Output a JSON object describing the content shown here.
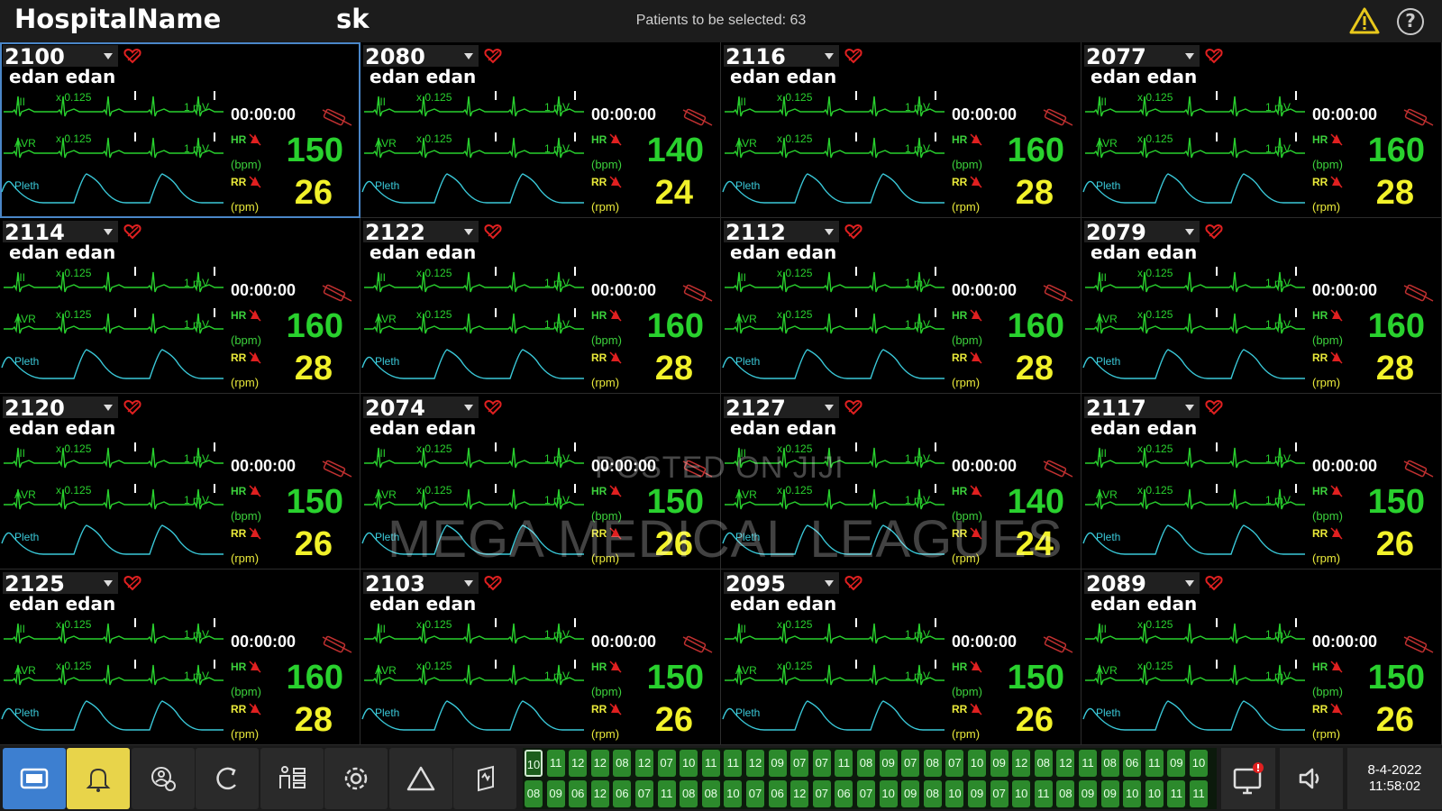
{
  "header": {
    "hospital_name": "HospitalName",
    "user": "sk",
    "patients_to_select": "Patients to be selected: 63"
  },
  "colors": {
    "ecg": "#29d12e",
    "pleth": "#3ac9d9",
    "hr": "#29d12e",
    "rr": "#f2f22a",
    "alarm": "#e02020",
    "selected_border": "#4a86c8"
  },
  "lead_labels": {
    "lead1": "III",
    "lead2": "AVR",
    "pleth": "Pleth",
    "gain": "x 0.125",
    "scale": "1 mV"
  },
  "units": {
    "hr_label": "HR",
    "hr_unit": "(bpm)",
    "rr_label": "RR",
    "rr_unit": "(rpm)"
  },
  "patients": [
    {
      "bed": "2100",
      "name": "edan edan",
      "time": "00:00:00",
      "hr": "150",
      "rr": "26"
    },
    {
      "bed": "2080",
      "name": "edan edan",
      "time": "00:00:00",
      "hr": "140",
      "rr": "24"
    },
    {
      "bed": "2116",
      "name": "edan edan",
      "time": "00:00:00",
      "hr": "160",
      "rr": "28"
    },
    {
      "bed": "2077",
      "name": "edan edan",
      "time": "00:00:00",
      "hr": "160",
      "rr": "28"
    },
    {
      "bed": "2114",
      "name": "edan edan",
      "time": "00:00:00",
      "hr": "160",
      "rr": "28"
    },
    {
      "bed": "2122",
      "name": "edan edan",
      "time": "00:00:00",
      "hr": "160",
      "rr": "28"
    },
    {
      "bed": "2112",
      "name": "edan edan",
      "time": "00:00:00",
      "hr": "160",
      "rr": "28"
    },
    {
      "bed": "2079",
      "name": "edan edan",
      "time": "00:00:00",
      "hr": "160",
      "rr": "28"
    },
    {
      "bed": "2120",
      "name": "edan edan",
      "time": "00:00:00",
      "hr": "150",
      "rr": "26"
    },
    {
      "bed": "2074",
      "name": "edan edan",
      "time": "00:00:00",
      "hr": "150",
      "rr": "26"
    },
    {
      "bed": "2127",
      "name": "edan edan",
      "time": "00:00:00",
      "hr": "140",
      "rr": "24"
    },
    {
      "bed": "2117",
      "name": "edan edan",
      "time": "00:00:00",
      "hr": "150",
      "rr": "26"
    },
    {
      "bed": "2125",
      "name": "edan edan",
      "time": "00:00:00",
      "hr": "160",
      "rr": "28"
    },
    {
      "bed": "2103",
      "name": "edan edan",
      "time": "00:00:00",
      "hr": "150",
      "rr": "26"
    },
    {
      "bed": "2095",
      "name": "edan edan",
      "time": "00:00:00",
      "hr": "150",
      "rr": "26"
    },
    {
      "bed": "2089",
      "name": "edan edan",
      "time": "00:00:00",
      "hr": "150",
      "rr": "26"
    }
  ],
  "watermark": {
    "line1": "POSTED ON JIJI",
    "line2": "MEGA MEDICAL LEAGUES"
  },
  "toolbar": {
    "icons": [
      "main-screen-icon",
      "alarm-bell-icon",
      "patient-admit-icon",
      "review-icon",
      "bed-view-icon",
      "settings-gear-icon",
      "alarm-limits-icon",
      "report-icon"
    ],
    "timeline_top": [
      "10",
      "11",
      "12",
      "12",
      "08",
      "12",
      "07",
      "10",
      "11",
      "11",
      "12",
      "09",
      "07",
      "07",
      "11",
      "08",
      "09",
      "07",
      "08",
      "07",
      "10",
      "09",
      "12",
      "08",
      "12",
      "11",
      "08",
      "06",
      "11",
      "09",
      "10"
    ],
    "timeline_bottom": [
      "08",
      "09",
      "06",
      "12",
      "06",
      "07",
      "11",
      "08",
      "08",
      "10",
      "07",
      "06",
      "12",
      "07",
      "06",
      "07",
      "10",
      "09",
      "08",
      "10",
      "09",
      "07",
      "10",
      "11",
      "08",
      "09",
      "09",
      "10",
      "10",
      "11",
      "11"
    ],
    "date": "8-4-2022",
    "time": "11:58:02"
  }
}
